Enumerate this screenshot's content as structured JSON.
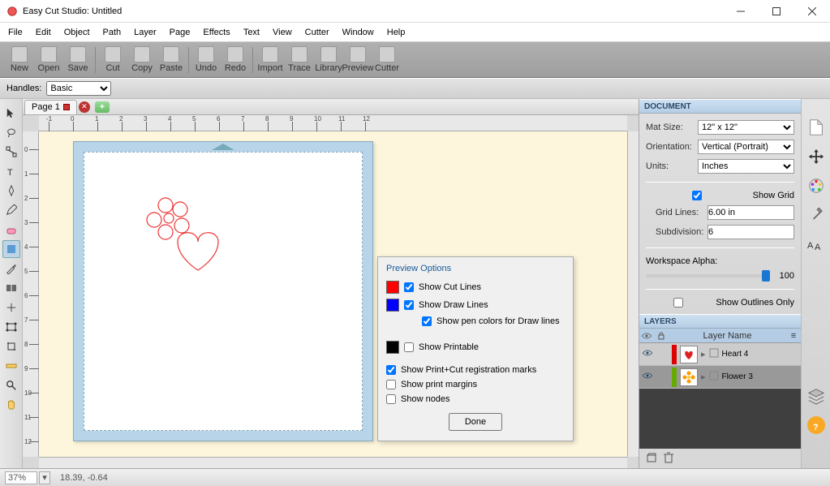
{
  "window": {
    "title": "Easy Cut Studio: Untitled"
  },
  "menu": [
    "File",
    "Edit",
    "Object",
    "Path",
    "Layer",
    "Page",
    "Effects",
    "Text",
    "View",
    "Cutter",
    "Window",
    "Help"
  ],
  "toolbar": [
    {
      "label": "New"
    },
    {
      "label": "Open"
    },
    {
      "label": "Save"
    },
    {
      "label": "Cut"
    },
    {
      "label": "Copy"
    },
    {
      "label": "Paste"
    },
    {
      "label": "Undo"
    },
    {
      "label": "Redo"
    },
    {
      "label": "Import"
    },
    {
      "label": "Trace"
    },
    {
      "label": "Library"
    },
    {
      "label": "Preview"
    },
    {
      "label": "Cutter"
    }
  ],
  "handles": {
    "label": "Handles:",
    "value": "Basic"
  },
  "page_tab": {
    "label": "Page 1"
  },
  "ruler_h": [
    "-1",
    "0",
    "1",
    "2",
    "3",
    "4",
    "5",
    "6",
    "7",
    "8",
    "9",
    "10",
    "11",
    "12"
  ],
  "ruler_v": [
    "0",
    "1",
    "2",
    "3",
    "4",
    "5",
    "6",
    "7",
    "8",
    "9",
    "10",
    "11",
    "12"
  ],
  "preview": {
    "title": "Preview Options",
    "cut_lines": {
      "label": "Show Cut Lines",
      "checked": true,
      "color": "#ff0000"
    },
    "draw_lines": {
      "label": "Show Draw Lines",
      "checked": true,
      "color": "#0000ff"
    },
    "pen_colors": {
      "label": "Show pen colors for Draw lines",
      "checked": true
    },
    "printable": {
      "label": "Show Printable",
      "checked": false,
      "color": "#000000"
    },
    "reg_marks": {
      "label": "Show Print+Cut registration marks",
      "checked": true
    },
    "margins": {
      "label": "Show print margins",
      "checked": false
    },
    "nodes": {
      "label": "Show nodes",
      "checked": false
    },
    "done": "Done"
  },
  "document": {
    "title": "DOCUMENT",
    "mat_size": {
      "label": "Mat Size:",
      "value": "12\" x 12\""
    },
    "orientation": {
      "label": "Orientation:",
      "value": "Vertical (Portrait)"
    },
    "units": {
      "label": "Units:",
      "value": "Inches"
    },
    "show_grid": {
      "label": "Show Grid",
      "checked": true
    },
    "grid_lines": {
      "label": "Grid Lines:",
      "value": "6.00 in"
    },
    "subdivision": {
      "label": "Subdivision:",
      "value": "6"
    },
    "workspace_alpha": {
      "label": "Workspace Alpha:",
      "value": "100"
    },
    "outlines": {
      "label": "Show Outlines Only",
      "checked": false
    }
  },
  "layers": {
    "title": "LAYERS",
    "header": "Layer Name",
    "items": [
      {
        "name": "Heart 4",
        "color": "#d00",
        "icon": "heart",
        "visible": true,
        "selected": false
      },
      {
        "name": "Flower 3",
        "color": "#6a0",
        "icon": "flower",
        "visible": true,
        "selected": true
      }
    ]
  },
  "status": {
    "zoom": "37%",
    "coords": "18.39, -0.64"
  }
}
